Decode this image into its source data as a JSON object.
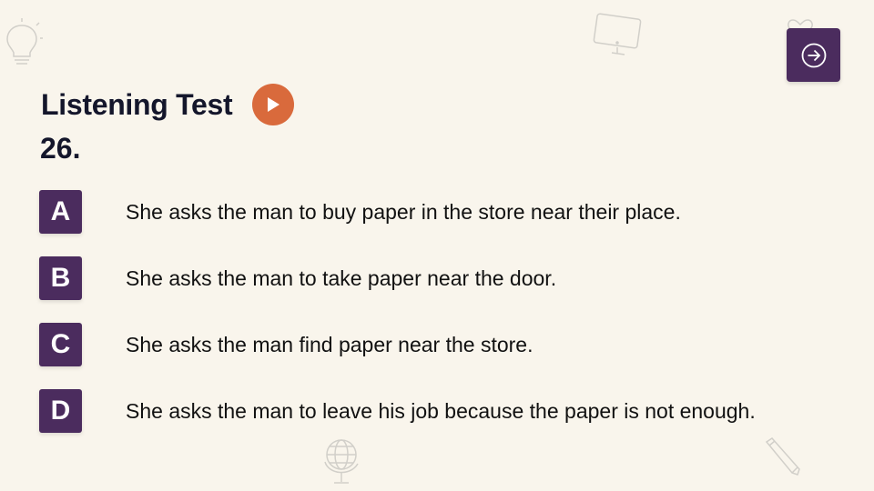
{
  "title": "Listening Test",
  "question_number": "26.",
  "options": [
    {
      "letter": "A",
      "text": "She asks the man to buy paper in the store near their place."
    },
    {
      "letter": "B",
      "text": "She asks the man to take paper near the door."
    },
    {
      "letter": "C",
      "text": "She asks the man find paper near the store."
    },
    {
      "letter": "D",
      "text": "She asks the man to leave his job because the paper is not enough."
    }
  ],
  "colors": {
    "background": "#f9f5ec",
    "accent_purple": "#4b2c5e",
    "play_orange": "#d96a3c",
    "title_text": "#14162b"
  },
  "icons": {
    "play": "play-icon",
    "next": "arrow-right-circle-icon",
    "decorations": [
      "lightbulb-icon",
      "monitor-icon",
      "heart-icon",
      "globe-icon",
      "pencil-icon"
    ]
  }
}
